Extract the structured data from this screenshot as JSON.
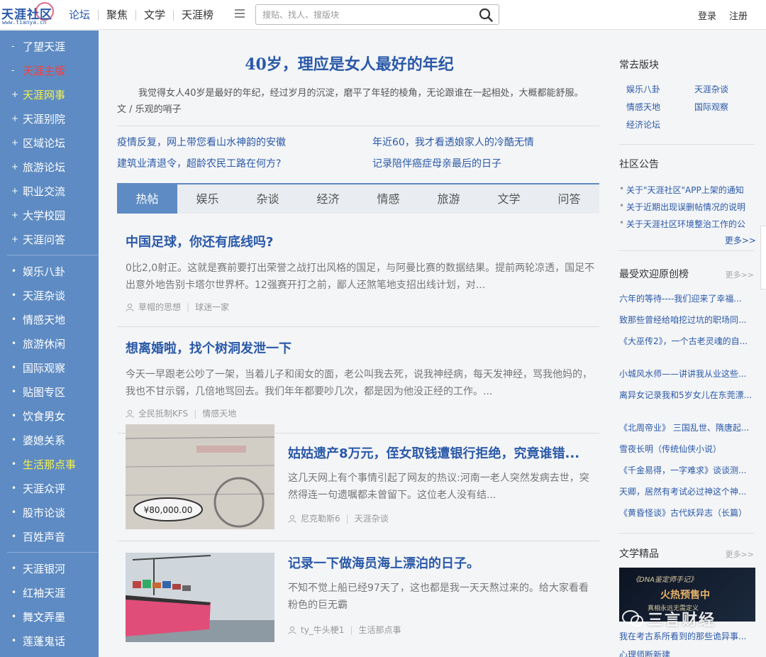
{
  "topbar": {
    "logo_text": "天涯社区",
    "logo_url": "www.tianya.cn",
    "nav": [
      "论坛",
      "聚焦",
      "文学",
      "天涯榜"
    ],
    "search_placeholder": "搜贴、找人、搜版块",
    "login": "登录",
    "register": "注册"
  },
  "sidebar": {
    "group1": [
      {
        "label": "了望天涯",
        "mark": "-",
        "color": "white"
      },
      {
        "label": "天涯主版",
        "mark": "-",
        "color": "red"
      },
      {
        "label": "天涯网事",
        "mark": "+",
        "color": "yellow"
      },
      {
        "label": "天涯别院",
        "mark": "+",
        "color": "white"
      },
      {
        "label": "区域论坛",
        "mark": "+",
        "color": "white"
      },
      {
        "label": "旅游论坛",
        "mark": "+",
        "color": "white"
      },
      {
        "label": "职业交流",
        "mark": "+",
        "color": "white"
      },
      {
        "label": "大学校园",
        "mark": "+",
        "color": "white"
      },
      {
        "label": "天涯问答",
        "mark": "+",
        "color": "white"
      }
    ],
    "group2": [
      {
        "label": "娱乐八卦",
        "mark": "•",
        "color": "white"
      },
      {
        "label": "天涯杂谈",
        "mark": "•",
        "color": "white"
      },
      {
        "label": "情感天地",
        "mark": "•",
        "color": "white"
      },
      {
        "label": "旅游休闲",
        "mark": "•",
        "color": "white"
      },
      {
        "label": "国际观察",
        "mark": "•",
        "color": "white"
      },
      {
        "label": "贴图专区",
        "mark": "•",
        "color": "white"
      },
      {
        "label": "饮食男女",
        "mark": "•",
        "color": "white"
      },
      {
        "label": "婆媳关系",
        "mark": "•",
        "color": "white"
      },
      {
        "label": "生活那点事",
        "mark": "•",
        "color": "yellow"
      },
      {
        "label": "天涯众评",
        "mark": "•",
        "color": "white"
      },
      {
        "label": "股市论谈",
        "mark": "•",
        "color": "white"
      },
      {
        "label": "百姓声音",
        "mark": "•",
        "color": "white"
      }
    ],
    "group3": [
      {
        "label": "天涯银河",
        "mark": "•",
        "color": "white"
      },
      {
        "label": "红袖天涯",
        "mark": "•",
        "color": "white"
      },
      {
        "label": "舞文弄墨",
        "mark": "•",
        "color": "white"
      },
      {
        "label": "莲蓬鬼话",
        "mark": "•",
        "color": "white"
      }
    ]
  },
  "main": {
    "headline": "40岁，理应是女人最好的年纪",
    "intro": "我觉得女人40岁是最好的年纪，经过岁月的沉淀，磨平了年轻的棱角，无论跟谁在一起相处，大概都能舒服。 文 / 乐观的哨子",
    "links": [
      "疫情反复，网上带您看山水神韵的安徽",
      "年近60，我才看透娘家人的冷酷无情",
      "建筑业清退令，超龄农民工路在何方?",
      "记录陪伴癌症母亲最后的日子"
    ],
    "tabs": [
      "热帖",
      "娱乐",
      "杂谈",
      "经济",
      "情感",
      "旅游",
      "文学",
      "问答"
    ],
    "posts": [
      {
        "title": "中国足球，你还有底线吗?",
        "summary": "0比2,0射正。这就是赛前要打出荣誉之战打出风格的国足，与阿曼比赛的数据结果。提前两轮凉透，国足不出意外地告别卡塔尔世界杯。12强赛开打之前，鄙人还煞笔地支招出线计划，对...",
        "author": "草帽的思想",
        "board": "球迷一家"
      },
      {
        "title": "想离婚啦，找个树洞发泄一下",
        "summary": "今天一早跟老公吵了一架，当着儿子和闺女的面，老公叫我去死，说我神经病，每天发神经，骂我他妈的，我也不甘示弱，几倍地骂回去。我们年年都要吵几次，都是因为他没正经的工作。...",
        "author": "全民抵制KFS",
        "board": "情感天地"
      },
      {
        "title": "姑姑遗产8万元，侄女取钱遭银行拒绝，究竟谁错...",
        "summary": "这几天网上有个事情引起了网友的热议:河南一老人突然发病去世，突然得连一句遗嘱都未曾留下。这位老人没有结...",
        "author": "尼克勒斯6",
        "board": "天涯杂谈",
        "thumb_text": "¥80,000.00"
      },
      {
        "title": "记录一下做海员海上漂泊的日子。",
        "summary": "不知不觉上船已经97天了，这也都是我一天天熬过来的。给大家看看粉色的巨无霸",
        "author": "ty_牛头梗1",
        "board": "生活那点事"
      }
    ]
  },
  "right": {
    "boards_title": "常去版块",
    "boards": [
      "娱乐八卦",
      "天涯杂谈",
      "情感天地",
      "国际观察",
      "经济论坛"
    ],
    "notice_title": "社区公告",
    "notices": [
      "关于\"天涯社区\"APP上架的通知",
      "关于近期出现误删帖情况的说明",
      "关于天涯社区环境整治工作的公"
    ],
    "notice_more": "更多>>",
    "original_title": "最受欢迎原创榜",
    "original_more": "更多>>",
    "originals": [
      "六年的等待----我们迎来了幸福...",
      "致那些曾经给咱挖过坑的职场同...",
      "《大巫传2》，一个古老灵魂的自...",
      "小城风水师——讲讲我从业这些...",
      "离异女记录我和5岁女儿在东莞漂...",
      "《北周帝业》 三国乱世、隋唐起...",
      "雪夜长明（传统仙侠小说）",
      "《千金易得，一字难求》谈谈测...",
      "天卿，居然有考试必过神这个神...",
      "《黄昏怪谈》古代妖异志（长篇）"
    ],
    "lit_title": "文学精品",
    "lit_more": "更多>>",
    "lit_banner_top": "《DNA鉴定师手记》",
    "lit_banner_mid": "火热预售中",
    "lit_banner_bottom": "真相永远无需定义",
    "lit_links": [
      "我在考古系所看到的那些诡异事...",
      "心理师断新建"
    ],
    "watermark": "三言财经"
  },
  "colors": {
    "accent": "#2a59a8",
    "sidebar": "#5e8bc3",
    "red_label": "#ff3b3b",
    "yellow_label": "#f5f14d"
  }
}
